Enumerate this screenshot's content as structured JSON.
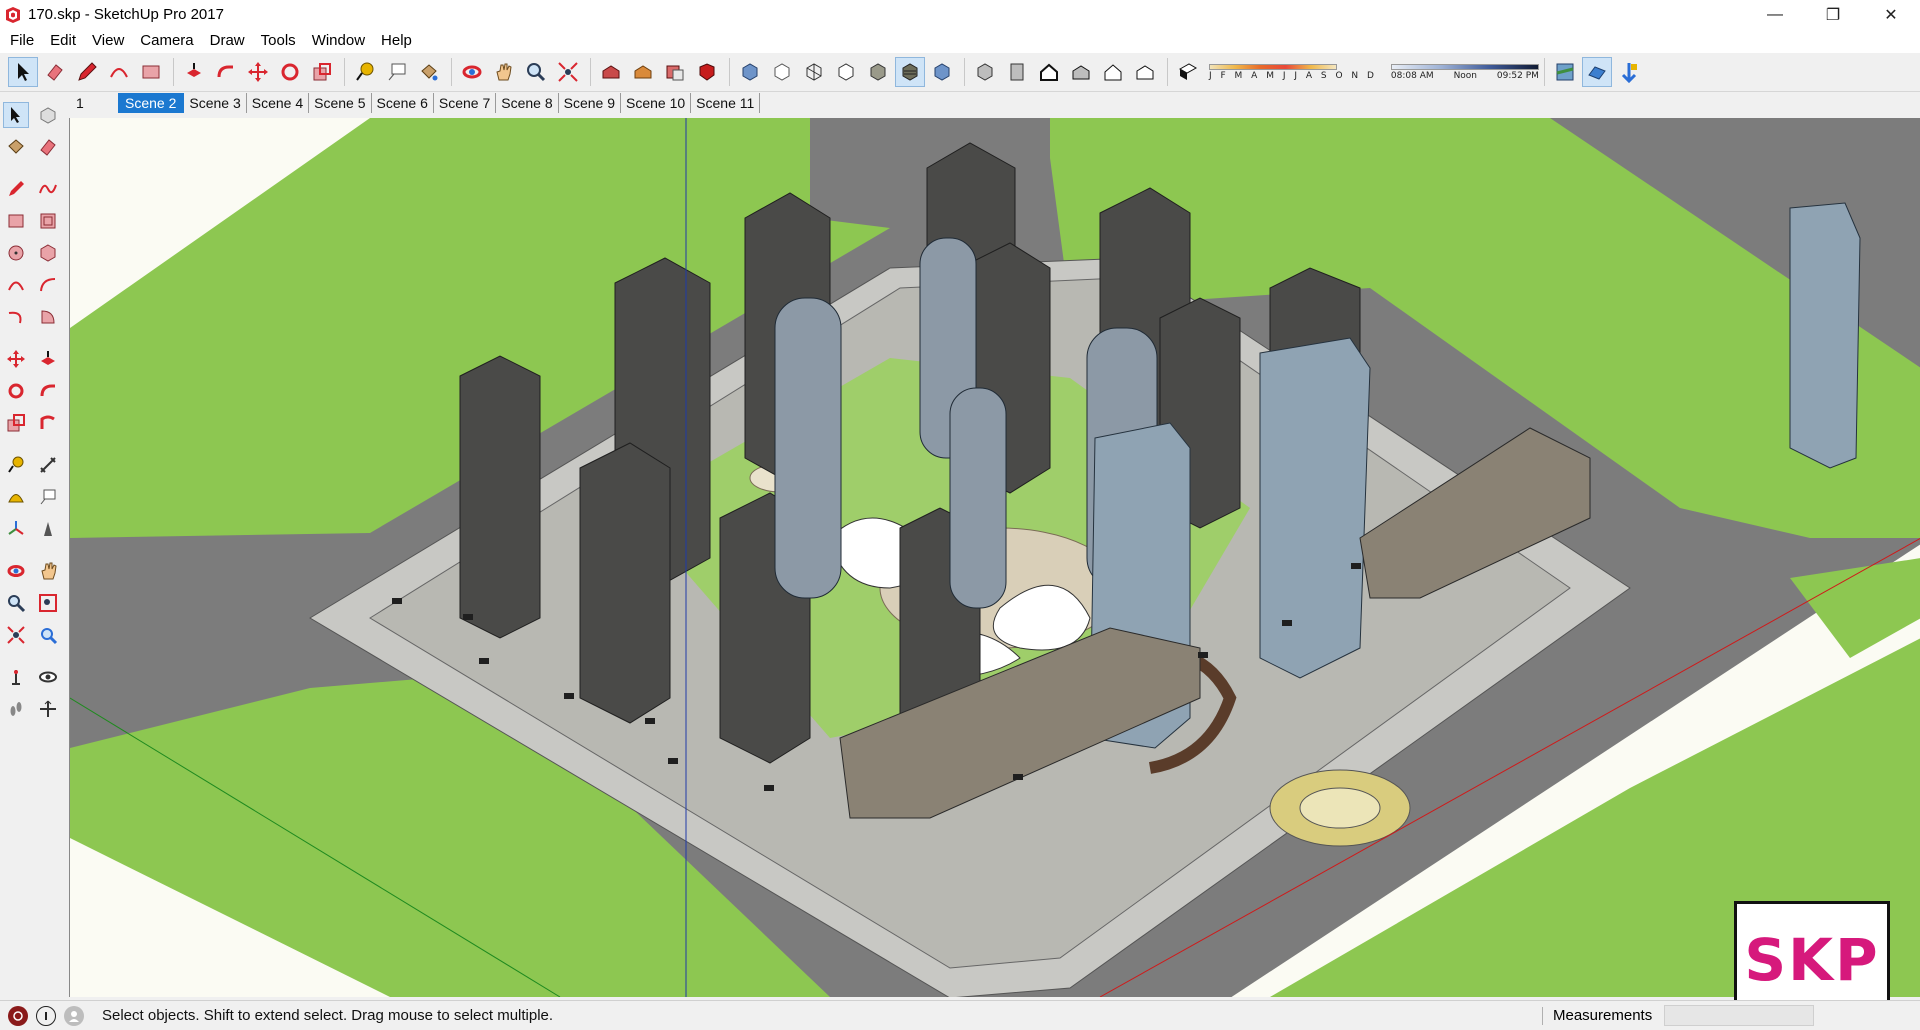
{
  "window": {
    "title": "170.skp - SketchUp Pro 2017",
    "minimize_glyph": "—",
    "maximize_glyph": "❐",
    "close_glyph": "✕"
  },
  "menu": {
    "items": [
      "File",
      "Edit",
      "View",
      "Camera",
      "Draw",
      "Tools",
      "Window",
      "Help"
    ]
  },
  "shadows": {
    "months": "J F M A M J J A S O N D",
    "time_start": "08:08 AM",
    "time_mid": "Noon",
    "time_end": "09:52 PM"
  },
  "scenes": {
    "first": "1",
    "tabs": [
      "Scene 2",
      "Scene 3",
      "Scene 4",
      "Scene 5",
      "Scene 6",
      "Scene 7",
      "Scene 8",
      "Scene 9",
      "Scene 10",
      "Scene 11"
    ],
    "selected": "Scene 2"
  },
  "status": {
    "hint": "Select objects. Shift to extend select. Drag mouse to select multiple.",
    "measurements_label": "Measurements",
    "measurements_value": ""
  },
  "watermark": {
    "text": "SKP"
  },
  "icons": {
    "app": "sketchup-logo-icon",
    "status": [
      "geo-location-icon",
      "credits-icon",
      "user-icon"
    ]
  },
  "colors": {
    "accent": "#1b78d0",
    "grass": "#8dc751",
    "road": "#7f7f7f",
    "plaza": "#c8c8c8",
    "building": "#4a4a4a",
    "glass": "#8fa3b3",
    "watermark": "#d6197c"
  }
}
